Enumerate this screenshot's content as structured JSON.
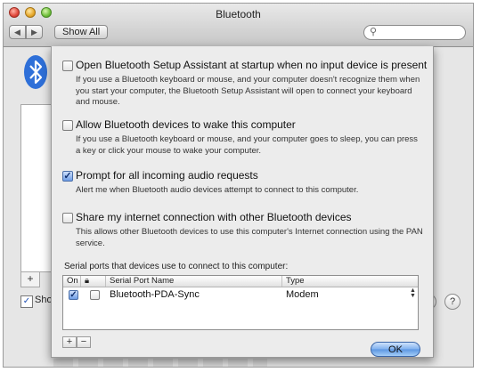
{
  "window": {
    "title": "Bluetooth",
    "show_all": "Show All",
    "search_placeholder": "",
    "background_checkbox_label": "Sho",
    "background_help": "?"
  },
  "sheet": {
    "options": [
      {
        "label": "Open Bluetooth Setup Assistant at startup when no input device is present",
        "description": "If you use a Bluetooth keyboard or mouse, and your computer doesn't recognize them when you start your computer, the Bluetooth Setup Assistant will open to connect your keyboard and mouse.",
        "checked": false
      },
      {
        "label": "Allow Bluetooth devices to wake this computer",
        "description": "If you use a Bluetooth keyboard or mouse, and your computer goes to sleep, you can press a key or click your mouse to wake your computer.",
        "checked": false
      },
      {
        "label": "Prompt for all incoming audio requests",
        "description": "Alert me when Bluetooth audio devices attempt to connect to this computer.",
        "checked": true
      },
      {
        "label": "Share my internet connection with other Bluetooth devices",
        "description": "This allows other Bluetooth devices to use this computer's Internet connection using the PAN service.",
        "checked": false
      }
    ],
    "serial_caption": "Serial ports that devices use to connect to this computer:",
    "table": {
      "columns": [
        "On",
        "",
        "Serial Port Name",
        "Type"
      ],
      "rows": [
        {
          "on": true,
          "secure": false,
          "name": "Bluetooth-PDA-Sync",
          "type": "Modem"
        }
      ]
    },
    "add_label": "+",
    "remove_label": "−",
    "ok_label": "OK"
  },
  "colors": {
    "ok_button": "#6ea4ea",
    "checkbox_checked": "#6e9de6"
  },
  "icons": [
    "bluetooth-icon",
    "search-icon",
    "lock-icon"
  ]
}
